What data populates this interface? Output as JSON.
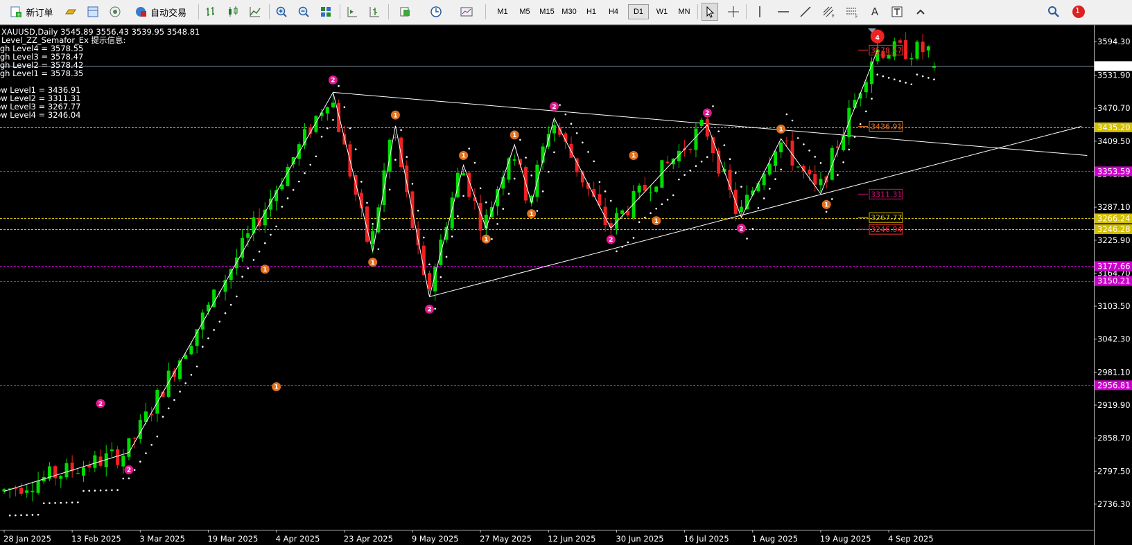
{
  "toolbar": {
    "new_order_label": "新订单",
    "auto_trade_label": "自动交易",
    "timeframes": [
      "M1",
      "M5",
      "M15",
      "M30",
      "H1",
      "H4",
      "D1",
      "W1",
      "MN"
    ],
    "active_timeframe": "D1",
    "notification_count": "1",
    "icons": [
      "new-order-icon",
      "gold-bar-icon",
      "data-window-icon",
      "signal-icon",
      "auto-trade-icon",
      "bar-chart-icon",
      "candle-chart-icon",
      "line-chart-icon",
      "zoom-in-icon",
      "zoom-out-icon",
      "tile-windows-icon",
      "autoscroll-icon",
      "chart-shift-icon",
      "indicators-icon",
      "periods-icon",
      "templates-icon",
      "cursor-icon",
      "crosshair-icon",
      "vertical-line-icon",
      "horizontal-line-icon",
      "trendline-icon",
      "fibonacci-icon",
      "channel-icon",
      "text-icon",
      "text-label-icon",
      "arrows-icon",
      "search-icon",
      "notification-icon"
    ]
  },
  "info": {
    "symbol_line": "XAUUSD,Daily  3545.89 3556.43 3539.95 3548.81",
    "indicator_line": "Level_ZZ_Semafor_Ex 提示信息:",
    "high_levels": [
      "High Level4 = 3578.55",
      "High Level3 = 3578.47",
      "High Level2 = 3578.42",
      "High Level1 = 3578.35"
    ],
    "low_levels": [
      "Low Level1 = 3436.91",
      "Low Level2 = 3311.31",
      "Low Level3 = 3267.77",
      "Low Level4 = 3246.04"
    ]
  },
  "chart_data": {
    "type": "candlestick",
    "symbol": "XAUUSD",
    "timeframe": "Daily",
    "ohlc_last": {
      "open": 3545.89,
      "high": 3556.43,
      "low": 3539.95,
      "close": 3548.81
    },
    "ylim": [
      2690,
      3620
    ],
    "yticks": [
      3594.3,
      3531.9,
      3470.7,
      3409.5,
      3348.3,
      3287.1,
      3225.9,
      3164.7,
      3103.5,
      3042.3,
      2981.1,
      2919.9,
      2858.7,
      2797.5,
      2736.3
    ],
    "xlabels": [
      {
        "label": "28 Jan 2025",
        "bar": 0
      },
      {
        "label": "13 Feb 2025",
        "bar": 12
      },
      {
        "label": "3 Mar 2025",
        "bar": 24
      },
      {
        "label": "19 Mar 2025",
        "bar": 36
      },
      {
        "label": "4 Apr 2025",
        "bar": 48
      },
      {
        "label": "23 Apr 2025",
        "bar": 60
      },
      {
        "label": "9 May 2025",
        "bar": 72
      },
      {
        "label": "27 May 2025",
        "bar": 84
      },
      {
        "label": "12 Jun 2025",
        "bar": 96
      },
      {
        "label": "30 Jun 2025",
        "bar": 108
      },
      {
        "label": "16 Jul 2025",
        "bar": 120
      },
      {
        "label": "1 Aug 2025",
        "bar": 132
      },
      {
        "label": "19 Aug 2025",
        "bar": 144
      },
      {
        "label": "4 Sep 2025",
        "bar": 156
      }
    ],
    "bar_count": 165,
    "price_line": 3548.81,
    "zigzag_pivots": [
      {
        "bar": 0,
        "price": 2760
      },
      {
        "bar": 22,
        "price": 2832
      },
      {
        "bar": 58,
        "price": 3500
      },
      {
        "bar": 65,
        "price": 3205
      },
      {
        "bar": 69,
        "price": 3438
      },
      {
        "bar": 75,
        "price": 3121
      },
      {
        "bar": 81,
        "price": 3365
      },
      {
        "bar": 85,
        "price": 3248
      },
      {
        "bar": 90,
        "price": 3403
      },
      {
        "bar": 93,
        "price": 3295
      },
      {
        "bar": 97,
        "price": 3452
      },
      {
        "bar": 107,
        "price": 3248
      },
      {
        "bar": 124,
        "price": 3440
      },
      {
        "bar": 130,
        "price": 3268
      },
      {
        "bar": 137,
        "price": 3414
      },
      {
        "bar": 144,
        "price": 3312
      },
      {
        "bar": 154,
        "price": 3578
      }
    ],
    "semafor_markers": [
      {
        "bar": 22,
        "price": 2800,
        "label": "2",
        "color": "#e0178c"
      },
      {
        "bar": 17,
        "price": 2923,
        "label": "2",
        "color": "#e0178c"
      },
      {
        "bar": 58,
        "price": 3523,
        "label": "2",
        "color": "#e0178c"
      },
      {
        "bar": 75,
        "price": 3098,
        "label": "2",
        "color": "#e0178c"
      },
      {
        "bar": 97,
        "price": 3474,
        "label": "2",
        "color": "#e0178c"
      },
      {
        "bar": 107,
        "price": 3227,
        "label": "2",
        "color": "#e0178c"
      },
      {
        "bar": 124,
        "price": 3462,
        "label": "2",
        "color": "#e0178c"
      },
      {
        "bar": 130,
        "price": 3248,
        "label": "2",
        "color": "#e0178c"
      },
      {
        "bar": 46,
        "price": 3172,
        "label": "1",
        "color": "#e07020"
      },
      {
        "bar": 48,
        "price": 2954,
        "label": "1",
        "color": "#e07020"
      },
      {
        "bar": 65,
        "price": 3185,
        "label": "1",
        "color": "#e07020"
      },
      {
        "bar": 69,
        "price": 3458,
        "label": "1",
        "color": "#e07020"
      },
      {
        "bar": 81,
        "price": 3383,
        "label": "1",
        "color": "#e07020"
      },
      {
        "bar": 85,
        "price": 3228,
        "label": "1",
        "color": "#e07020"
      },
      {
        "bar": 90,
        "price": 3421,
        "label": "1",
        "color": "#e07020"
      },
      {
        "bar": 93,
        "price": 3275,
        "label": "1",
        "color": "#e07020"
      },
      {
        "bar": 111,
        "price": 3383,
        "label": "1",
        "color": "#e07020"
      },
      {
        "bar": 115,
        "price": 3262,
        "label": "1",
        "color": "#e07020"
      },
      {
        "bar": 137,
        "price": 3432,
        "label": "1",
        "color": "#e07020"
      },
      {
        "bar": 145,
        "price": 3292,
        "label": "1",
        "color": "#e07020"
      },
      {
        "bar": 154,
        "price": 3604,
        "label": "4",
        "color": "#ee2222"
      }
    ],
    "trendlines": [
      {
        "from": {
          "bar": 58,
          "price": 3500
        },
        "to": {
          "bar": 191,
          "price": 3383
        }
      },
      {
        "from": {
          "bar": 75,
          "price": 3121
        },
        "to": {
          "bar": 190,
          "price": 3437
        }
      }
    ],
    "horizontal_levels": [
      {
        "price": 3435.2,
        "label": "3435.20",
        "color": "#d4c000",
        "style": "dashed",
        "axis_label": true
      },
      {
        "price": 3353.59,
        "label": "3353.59",
        "color": "#cc00cc",
        "style": "dashed",
        "axis_label": true
      },
      {
        "price": 3266.24,
        "label": "3266.24",
        "color": "#d4c000",
        "style": "dashed",
        "axis_label": true
      },
      {
        "price": 3246.28,
        "label": "3246.28",
        "color": "#d4c000",
        "style": "dashed",
        "axis_label": true
      },
      {
        "price": 3177.66,
        "label": "3177.66",
        "color": "#cc00cc",
        "style": "dashed",
        "axis_label": true
      },
      {
        "price": 3150.21,
        "label": "3150.21",
        "color": "#cc00cc",
        "style": "dashed",
        "axis_label": true
      },
      {
        "price": 2956.81,
        "label": "2956.81",
        "color": "#cc00cc",
        "style": "dashed",
        "axis_label": true
      }
    ],
    "level_tags": [
      {
        "price": 3578.47,
        "label": "3578.47",
        "color": "#ee3333"
      },
      {
        "price": 3436.91,
        "label": "3436.91",
        "color": "#e07020"
      },
      {
        "price": 3311.31,
        "label": "3311.31",
        "color": "#cc1177"
      },
      {
        "price": 3267.77,
        "label": "3267.77",
        "color": "#d4c000"
      },
      {
        "price": 3246.04,
        "label": "3246.04",
        "color": "#ee3333"
      }
    ],
    "colors": {
      "bull": "#00dd00",
      "bear": "#ee2222",
      "background": "#000000",
      "text": "#ffffff",
      "zigzag": "#ffffff",
      "sar": "#ffffff",
      "price_line": "#8090a0"
    }
  }
}
